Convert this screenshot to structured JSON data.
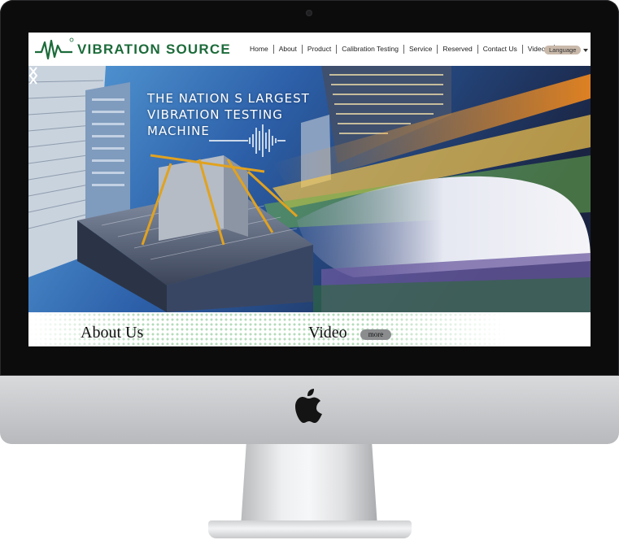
{
  "site": {
    "logo_text": "VIBRATION SOURCE",
    "brand_color": "#1c6b3a"
  },
  "nav": {
    "items": [
      "Home",
      "About",
      "Product",
      "Calibration Testing",
      "Service",
      "Reserved",
      "Contact Us",
      "Videos"
    ],
    "language_label": "Language"
  },
  "hero": {
    "title_line1": "THE NATION S LARGEST",
    "title_line2": "VIBRATION TESTING",
    "title_line3": "MACHINE"
  },
  "strip": {
    "about_label": "About Us",
    "video_label": "Video",
    "more_label": "more"
  },
  "icons": [
    "apple-logo",
    "arrow-left-icon",
    "arrow-right-icon",
    "chevron-down-icon",
    "soundwave-icon"
  ]
}
